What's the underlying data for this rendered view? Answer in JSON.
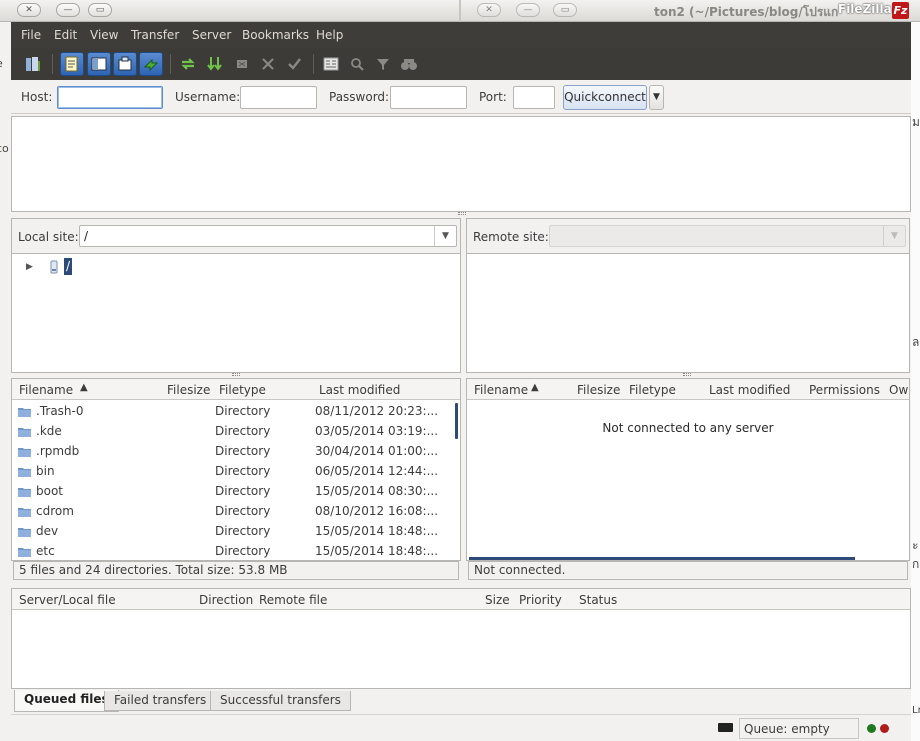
{
  "window": {
    "title": "ton2 (~/Pictures/blog/โปรแก",
    "app_name": "FileZilla",
    "logo_letter": "Fz"
  },
  "background": {
    "left_fragments": [
      "e",
      "co"
    ],
    "right_fragments": [
      "ม",
      "ล",
      "ะ",
      "ก",
      "Lr"
    ]
  },
  "menu": [
    "File",
    "Edit",
    "View",
    "Transfer",
    "Server",
    "Bookmarks",
    "Help"
  ],
  "toolbar": {
    "icons": [
      "site-manager-icon",
      "toggle-message-log-icon",
      "toggle-local-tree-icon",
      "toggle-remote-tree-icon",
      "toggle-transfer-queue-icon",
      "refresh-icon",
      "process-queue-icon",
      "cancel-operation-icon",
      "disconnect-icon",
      "reconnect-icon",
      "directory-comparison-icon",
      "synchronized-browsing-icon",
      "filter-icon",
      "search-files-icon"
    ]
  },
  "quickconnect": {
    "host_label": "Host:",
    "host_value": "",
    "username_label": "Username:",
    "username_value": "",
    "password_label": "Password:",
    "password_value": "",
    "port_label": "Port:",
    "port_value": "",
    "button_label": "Quickconnect"
  },
  "local": {
    "site_label": "Local site:",
    "site_value": "/",
    "tree_root": "/",
    "columns": [
      "Filename",
      "Filesize",
      "Filetype",
      "Last modified"
    ],
    "files": [
      {
        "name": ".Trash-0",
        "size": "",
        "type": "Directory",
        "modified": "08/11/2012 20:23:..."
      },
      {
        "name": ".kde",
        "size": "",
        "type": "Directory",
        "modified": "03/05/2014 03:19:..."
      },
      {
        "name": ".rpmdb",
        "size": "",
        "type": "Directory",
        "modified": "30/04/2014 01:00:..."
      },
      {
        "name": "bin",
        "size": "",
        "type": "Directory",
        "modified": "06/05/2014 12:44:..."
      },
      {
        "name": "boot",
        "size": "",
        "type": "Directory",
        "modified": "15/05/2014 08:30:..."
      },
      {
        "name": "cdrom",
        "size": "",
        "type": "Directory",
        "modified": "08/10/2012 16:08:..."
      },
      {
        "name": "dev",
        "size": "",
        "type": "Directory",
        "modified": "15/05/2014 18:48:..."
      },
      {
        "name": "etc",
        "size": "",
        "type": "Directory",
        "modified": "15/05/2014 18:48:..."
      }
    ],
    "status": "5 files and 24 directories. Total size: 53.8 MB"
  },
  "remote": {
    "site_label": "Remote site:",
    "site_value": "",
    "columns": [
      "Filename",
      "Filesize",
      "Filetype",
      "Last modified",
      "Permissions",
      "Own"
    ],
    "empty_message": "Not connected to any server",
    "status": "Not connected."
  },
  "queue": {
    "columns": [
      "Server/Local file",
      "Direction",
      "Remote file",
      "Size",
      "Priority",
      "Status"
    ],
    "tabs": [
      "Queued files",
      "Failed transfers",
      "Successful transfers"
    ],
    "status": "Queue: empty"
  },
  "colors": {
    "menubar": "#3e3d39",
    "selection": "#2c4b78",
    "led_upload": "#1e7a1e",
    "led_download": "#b01c1c"
  }
}
